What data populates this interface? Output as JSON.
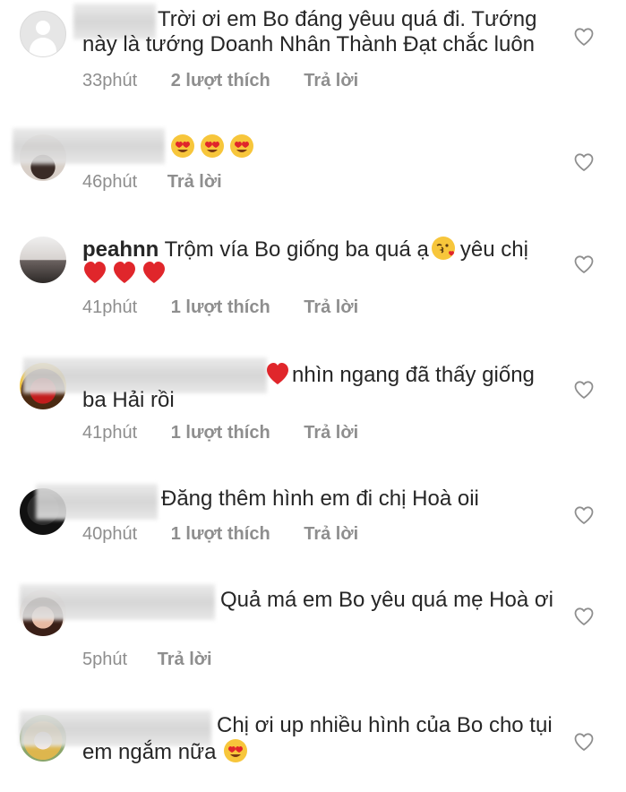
{
  "comments": [
    {
      "username": "",
      "text": "Trời ơi em Bo đáng yêuu quá đi. Tướng này là tướng Doanh Nhân Thành Đạt chắc luôn",
      "time": "33phút",
      "likes": "2 lượt thích",
      "reply": "Trả lời"
    },
    {
      "username": "",
      "text": "",
      "emojis": [
        "heart-eyes",
        "heart-eyes",
        "heart-eyes"
      ],
      "time": "46phút",
      "likes": "",
      "reply": "Trả lời"
    },
    {
      "username": "peahnn",
      "text": "Trộm vía Bo giống ba quá ạ",
      "text_after": "yêu chị",
      "emojis": [
        "kiss-heart"
      ],
      "emojis_line2": [
        "red-heart",
        "red-heart",
        "red-heart"
      ],
      "time": "41phút",
      "likes": "1 lượt thích",
      "reply": "Trả lời"
    },
    {
      "username": "",
      "text": "nhìn ngang đã thấy giống ba Hải rồi",
      "emojis": [
        "red-heart"
      ],
      "time": "41phút",
      "likes": "1 lượt thích",
      "reply": "Trả lời"
    },
    {
      "username": "",
      "text": "Đăng thêm hình em đi chị Hoà oii",
      "time": "40phút",
      "likes": "1 lượt thích",
      "reply": "Trả lời"
    },
    {
      "username": "",
      "text": "Quả má em Bo yêu quá mẹ Hoà ơi",
      "time": "5phút",
      "likes": "",
      "reply": "Trả lời"
    },
    {
      "username": "",
      "text": "Chị ơi up nhiều hình của Bo cho tụi em ngắm nữa",
      "emojis": [
        "heart-eyes"
      ],
      "time": "",
      "likes": "",
      "reply": ""
    }
  ],
  "icons": {
    "like": "heart-outline-icon",
    "heart_eyes": "heart-eyes-emoji",
    "kiss_heart": "kiss-heart-emoji",
    "red_heart": "red-heart-emoji"
  },
  "colors": {
    "text": "#262626",
    "meta": "#8e8e8e",
    "emoji_yellow": "#f7c63b",
    "heart_red": "#e0262b"
  }
}
